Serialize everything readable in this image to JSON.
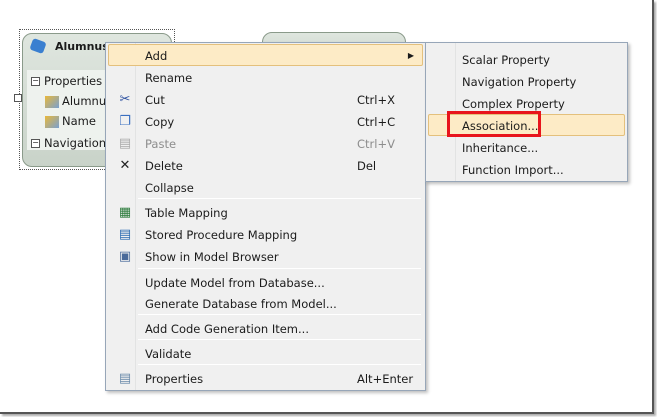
{
  "entities": [
    {
      "title": "Alumnus",
      "section_properties": "Properties",
      "properties": [
        "Alumnus",
        "Name"
      ],
      "section_navigation": "Navigation"
    }
  ],
  "context_menu": {
    "items": [
      {
        "label": "Add",
        "shortcut": "",
        "icon": "",
        "submenu": true,
        "highlighted": true
      },
      {
        "label": "Rename",
        "shortcut": "",
        "icon": ""
      },
      {
        "label": "Cut",
        "shortcut": "Ctrl+X",
        "icon": "scissors-icon"
      },
      {
        "label": "Copy",
        "shortcut": "Ctrl+C",
        "icon": "copy-icon"
      },
      {
        "label": "Paste",
        "shortcut": "Ctrl+V",
        "icon": "paste-icon",
        "disabled": true
      },
      {
        "label": "Delete",
        "shortcut": "Del",
        "icon": "delete-x-icon"
      },
      {
        "label": "Collapse",
        "shortcut": "",
        "icon": ""
      },
      {
        "label": "Table Mapping",
        "shortcut": "",
        "icon": "table-mapping-icon"
      },
      {
        "label": "Stored Procedure Mapping",
        "shortcut": "",
        "icon": "stored-procedure-icon"
      },
      {
        "label": "Show in Model Browser",
        "shortcut": "",
        "icon": "model-browser-icon"
      },
      {
        "label": "Update Model from Database...",
        "shortcut": "",
        "icon": ""
      },
      {
        "label": "Generate Database from Model...",
        "shortcut": "",
        "icon": ""
      },
      {
        "label": "Add Code Generation Item...",
        "shortcut": "",
        "icon": ""
      },
      {
        "label": "Validate",
        "shortcut": "",
        "icon": ""
      },
      {
        "label": "Properties",
        "shortcut": "Alt+Enter",
        "icon": "properties-icon"
      }
    ]
  },
  "submenu": {
    "items": [
      "Scalar Property",
      "Navigation Property",
      "Complex Property",
      "Association...",
      "Inheritance...",
      "Function Import..."
    ],
    "highlighted": "Association..."
  },
  "colors": {
    "highlight": "#fdebc6",
    "annotation": "#e8141c"
  }
}
